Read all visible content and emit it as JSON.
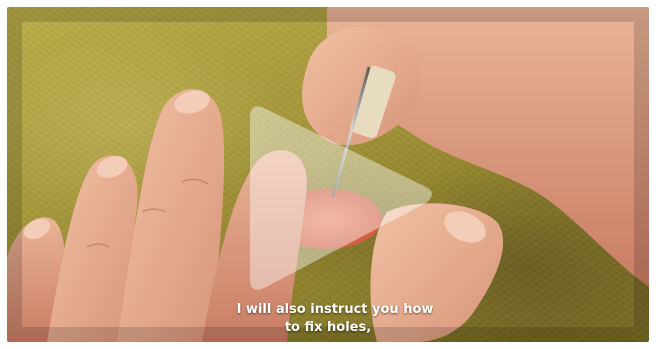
{
  "player": {
    "play_icon": "play-icon",
    "subtitle_line1": "I will also instruct you how",
    "subtitle_line2": "to fix holes,"
  },
  "colors": {
    "fabric": "#a89a3c",
    "skin": "#e3a98a",
    "felt": "#e8735a",
    "subtitle": "#ffffff"
  }
}
